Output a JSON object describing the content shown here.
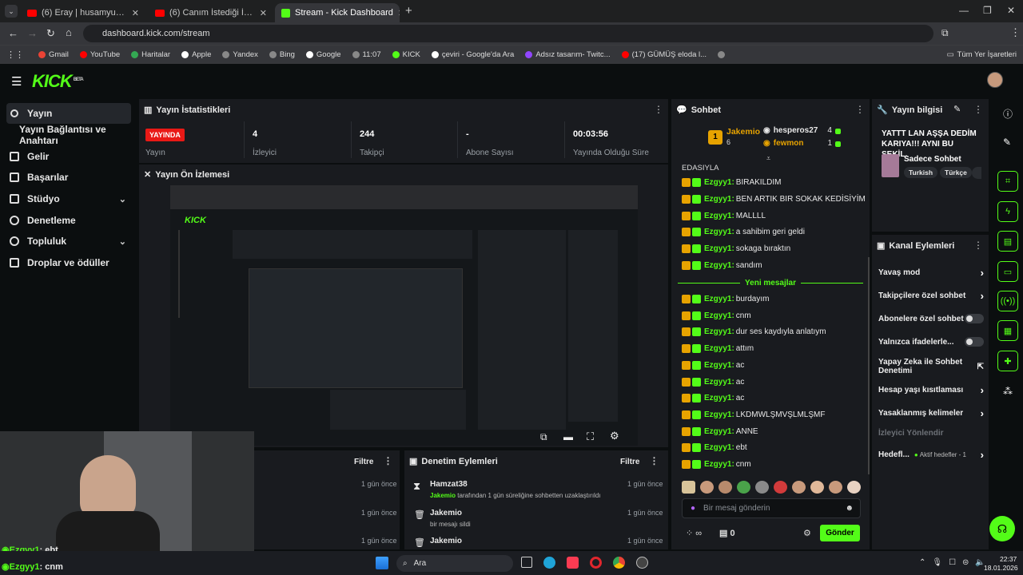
{
  "browser": {
    "tabs": [
      {
        "label": "(6) Eray | husamyuyu yayın yakı"
      },
      {
        "label": "(6) Canım İstediği İçin Aldıklarım"
      },
      {
        "label": "Stream - Kick Dashboard"
      }
    ],
    "url": "dashboard.kick.com/stream",
    "bookmarks": [
      "Gmail",
      "YouTube",
      "Haritalar",
      "Apple",
      "Yandex",
      "Bing",
      "Google",
      "11:07",
      "KICK",
      "çeviri - Google'da Ara",
      "Adsız tasarım- Twitc...",
      "(17) GÜMÜŞ eloda l..."
    ],
    "all_bookmarks": "Tüm Yer İşaretleri"
  },
  "app": {
    "logo": "KICK",
    "beta": "BETA"
  },
  "sidebar": {
    "items": [
      {
        "label": "Yayın"
      },
      {
        "label": "Yayın Bağlantısı ve Anahtarı"
      },
      {
        "label": "Gelir"
      },
      {
        "label": "Başarılar"
      },
      {
        "label": "Stüdyo"
      },
      {
        "label": "Denetleme"
      },
      {
        "label": "Topluluk"
      },
      {
        "label": "Droplar ve ödüller"
      }
    ]
  },
  "stats": {
    "title": "Yayın İstatistikleri",
    "live": "YAYINDA",
    "live_label": "Yayın",
    "items": [
      {
        "value": "4",
        "label": "İzleyici"
      },
      {
        "value": "244",
        "label": "Takipçi"
      },
      {
        "value": "-",
        "label": "Abone Sayısı"
      },
      {
        "value": "00:03:56",
        "label": "Yayında Olduğu Süre"
      }
    ]
  },
  "preview": {
    "title": "Yayın Ön İzlemesi"
  },
  "log": {
    "filter": "Filtre",
    "times": [
      "1 gün önce",
      "1 gün önce",
      "1 gün önce"
    ]
  },
  "mod": {
    "title": "Denetim Eylemleri",
    "filter": "Filtre",
    "entries": [
      {
        "user": "Hamzat38",
        "actor": "Jakemio",
        "text": "tarafından 1 gün süreliğine sohbetten uzaklaştırıldı",
        "time": "1 gün önce"
      },
      {
        "user": "Jakemio",
        "text": "bir mesajı sildi",
        "time": "1 gün önce"
      },
      {
        "user": "Jakemio",
        "time": "1 gün önce"
      }
    ]
  },
  "chat": {
    "title": "Sohbet",
    "top": [
      {
        "rank": "1",
        "name": "Jakemio",
        "count": "6"
      },
      {
        "name": "hesperos27",
        "count": "4"
      },
      {
        "name": "fewmon",
        "count": "1"
      }
    ],
    "pre": "EDASIYLA",
    "messages": [
      {
        "user": "Ezgyy1",
        "text": "BIRAKILDIM"
      },
      {
        "user": "Ezgyy1",
        "text": "BEN ARTIK BIR SOKAK KEDİSİYİM"
      },
      {
        "user": "Ezgyy1",
        "text": "MALLLL"
      },
      {
        "user": "Ezgyy1",
        "text": "a sahibim geri geldi"
      },
      {
        "user": "Ezgyy1",
        "text": "sokaga bıraktın"
      },
      {
        "user": "Ezgyy1",
        "text": "sandım"
      }
    ],
    "new_divider": "Yeni mesajlar",
    "messages2": [
      {
        "user": "Ezgyy1",
        "text": "burdayım"
      },
      {
        "user": "Ezgyy1",
        "text": "cnm"
      },
      {
        "user": "Ezgyy1",
        "text": "dur ses kaydıyla anlatıym"
      },
      {
        "user": "Ezgyy1",
        "text": "attım"
      },
      {
        "user": "Ezgyy1",
        "text": "ac"
      },
      {
        "user": "Ezgyy1",
        "text": "ac"
      },
      {
        "user": "Ezgyy1",
        "text": "ac"
      },
      {
        "user": "Ezgyy1",
        "text": "LKDMWLŞMVŞLMLŞMF"
      },
      {
        "user": "Ezgyy1",
        "text": "ANNE"
      },
      {
        "user": "Ezgyy1",
        "text": "ebt"
      },
      {
        "user": "Ezgyy1",
        "text": "cnm"
      }
    ],
    "placeholder": "Bir mesaj gönderin",
    "send": "Gönder",
    "viewers": "0",
    "infinite": "∞"
  },
  "info": {
    "title": "Yayın bilgisi",
    "stream_title": "YATTT LAN AŞŞA DEDİM KARIYA!!! AYNI BU ŞEKİL.",
    "category": "Sadece Sohbet",
    "tags": [
      "Turkish",
      "Türkçe"
    ]
  },
  "channel": {
    "title": "Kanal Eylemleri",
    "rows": [
      {
        "label": "Yavaş mod"
      },
      {
        "label": "Takipçilere özel sohbet"
      },
      {
        "label": "Abonelere özel sohbet"
      },
      {
        "label": "Yalnızca ifadelerle..."
      },
      {
        "label": "Yapay Zeka ile Sohbet Denetimi"
      },
      {
        "label": "Hesap yaşı kısıtlaması"
      },
      {
        "label": "Yasaklanmış kelimeler"
      },
      {
        "label": "İzleyici Yönlendir"
      },
      {
        "label": "Hedefl...",
        "sub": "Aktif hedefler - 1"
      }
    ]
  },
  "overlay": {
    "chat": [
      {
        "user": "Ezgyy1",
        "text": ": ebt"
      },
      {
        "user": "Ezgyy1",
        "text": ": cnm"
      }
    ]
  },
  "taskbar": {
    "search": "Ara",
    "time": "22:37",
    "date": "18.01.2026"
  }
}
